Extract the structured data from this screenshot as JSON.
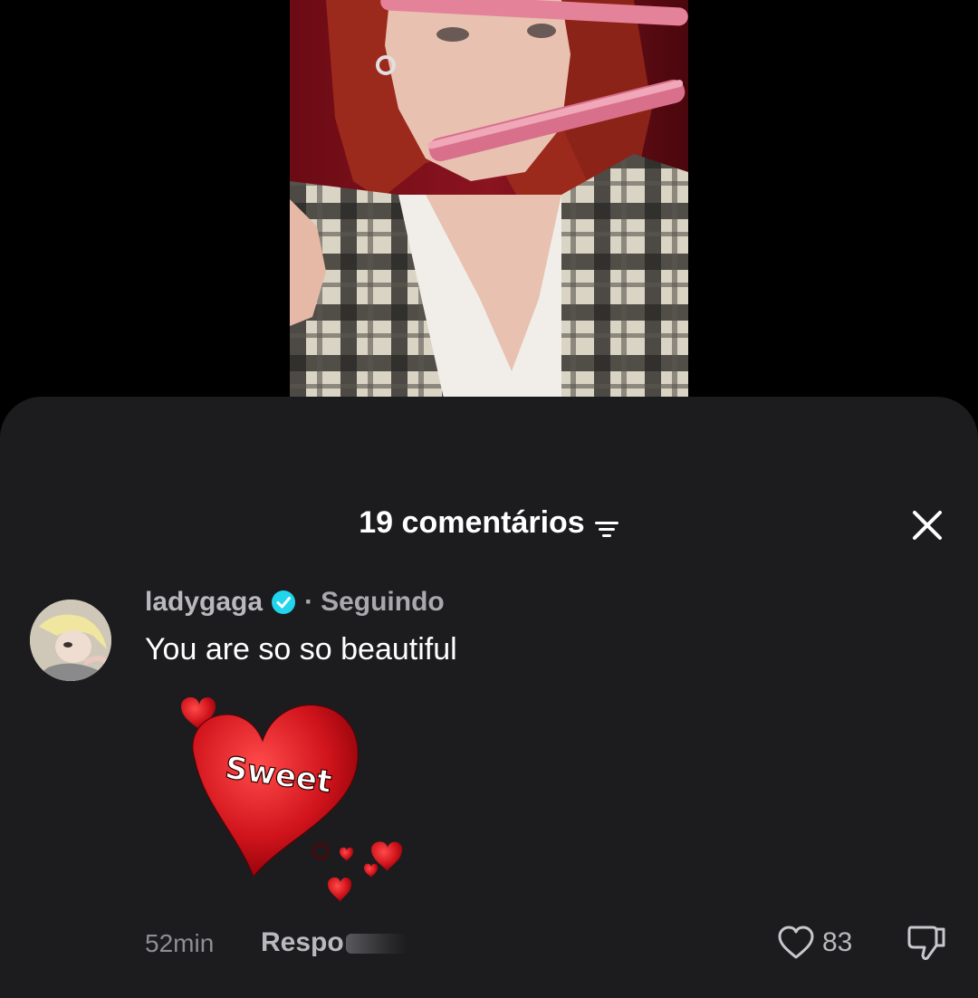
{
  "comments_header": {
    "count_label": "19 comentários",
    "filter_icon": "filter-icon",
    "close_icon": "close-icon"
  },
  "comment": {
    "username": "ladygaga",
    "verified_icon": "verified-badge-icon",
    "separator": "·",
    "follow_status": "Seguindo",
    "text": "You are so so beautiful",
    "sticker_text": "Sweet",
    "timestamp": "52min",
    "reply_label": "Respo",
    "like_icon": "heart-outline-icon",
    "like_count": "83",
    "dislike_icon": "thumbs-down-icon"
  },
  "colors": {
    "sheet_background": "#1c1c1e",
    "verified_blue": "#20d5ec",
    "heart_red": "#d1141c"
  }
}
